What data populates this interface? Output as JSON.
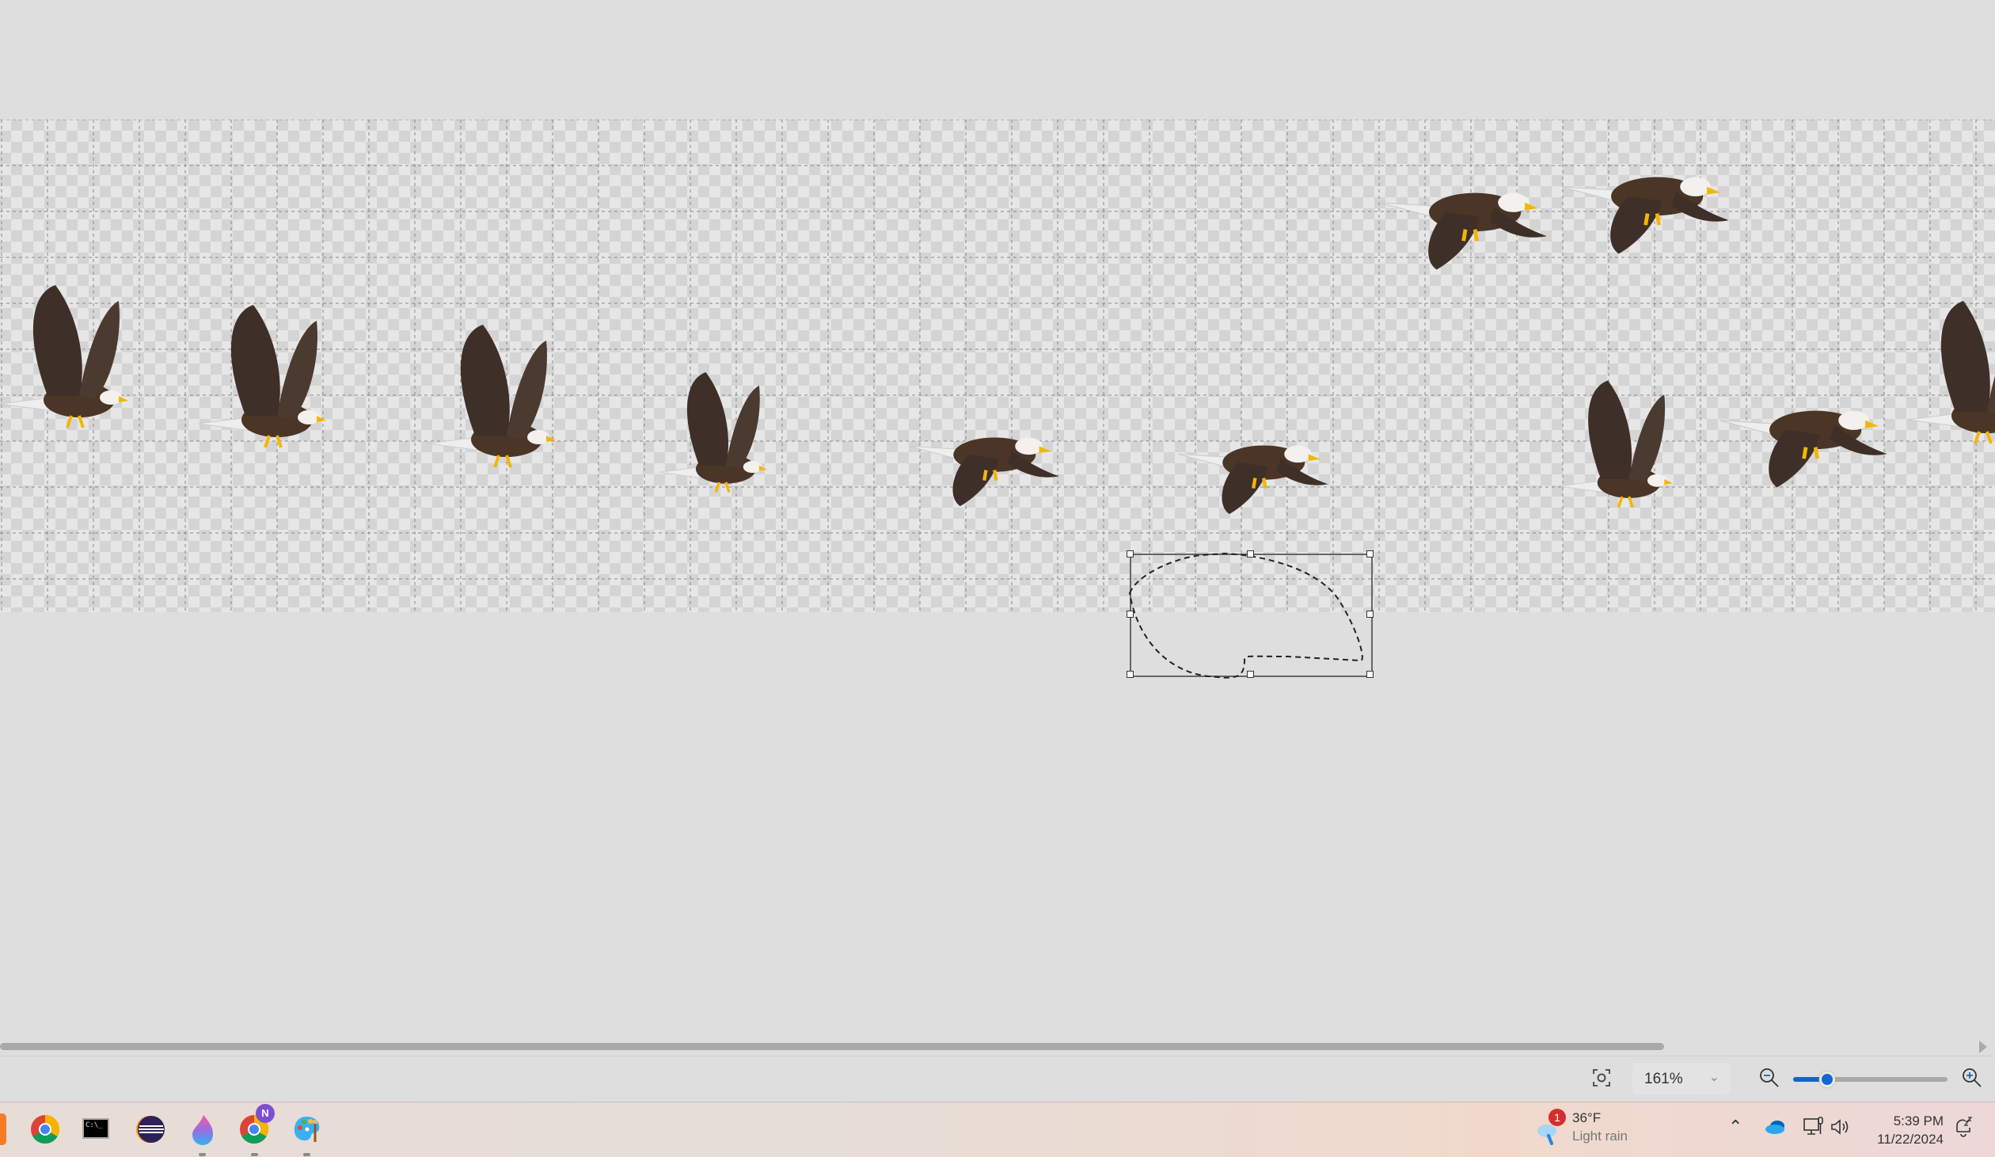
{
  "statusbar": {
    "zoom_value": "161%",
    "zoom_slider_percent": 22,
    "icons": [
      "fit-to-screen-icon",
      "chevron-down-icon",
      "zoom-out-icon",
      "zoom-in-icon"
    ]
  },
  "taskbar": {
    "apps": [
      "app-orange",
      "chrome",
      "command-prompt",
      "eclipse",
      "paint-drop",
      "chrome-profile-n",
      "paint"
    ],
    "chrome_profile_badge": "N",
    "weather": {
      "badge": "1",
      "temp": "36°F",
      "condition": "Light rain"
    },
    "clock": {
      "time": "5:39 PM",
      "date": "11/22/2024"
    }
  },
  "colors": {
    "accent": "#1567d3",
    "eagle_body": "#4a3526",
    "eagle_wing": "#3e2f28"
  }
}
